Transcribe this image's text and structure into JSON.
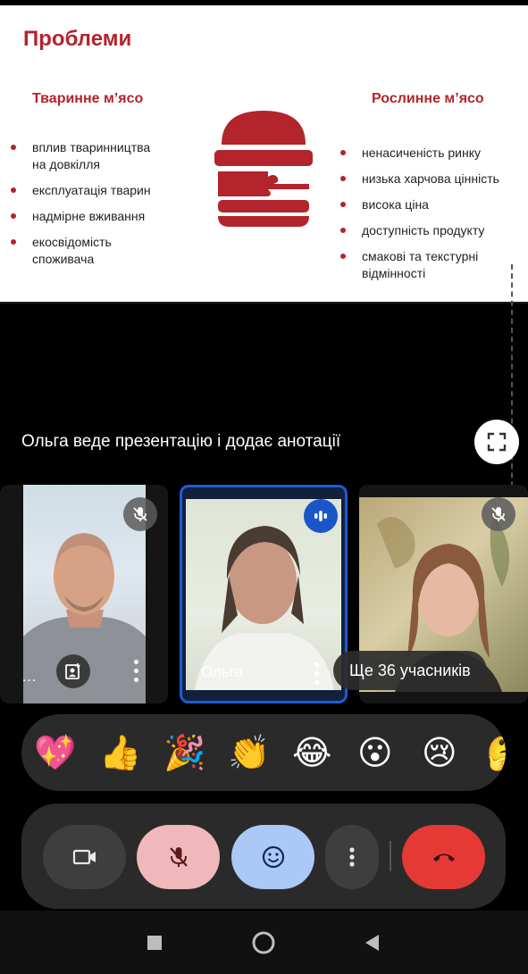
{
  "slide": {
    "title": "Проблеми",
    "left_heading": "Тваринне м’ясо",
    "right_heading": "Рослинне м’ясо",
    "left_items": [
      "вплив тваринництва на довкілля",
      "експлуатація тварин",
      "надмірне вживання",
      "екосвідомість споживача"
    ],
    "right_items": [
      "ненасиченість ринку",
      "низька харчова цінність",
      "висока ціна",
      "доступність продукту",
      "смакові та текстурні відмінності"
    ],
    "accent_color": "#b3242c",
    "burger_icon": "burger-puzzle-icon"
  },
  "presentation": {
    "notice": "Ольга веде презентацію і додає анотації",
    "fullscreen_icon": "fullscreen-icon"
  },
  "participants": {
    "tile1": {
      "name": "…",
      "mic_state": "muted"
    },
    "tile2": {
      "name": "Ольга",
      "mic_state": "speaking",
      "highlight_color": "#1e5bd6"
    },
    "tile3": {
      "mic_state": "muted"
    },
    "more_label": "Ще 36 учасників"
  },
  "reactions": [
    "💖",
    "👍",
    "🎉",
    "👏",
    "😂",
    "😮",
    "😢",
    "🤔"
  ],
  "controls": {
    "camera_icon": "video-camera-icon",
    "mic_icon": "mic-off-icon",
    "emoji_icon": "emoji-icon",
    "more_icon": "more-vert-icon",
    "hangup_icon": "call-end-icon",
    "hangup_color": "#e53935",
    "mic_off_color": "#f1b8bb",
    "emoji_color": "#acc8f6"
  },
  "navigation": [
    "recents-button",
    "home-button",
    "back-button"
  ]
}
